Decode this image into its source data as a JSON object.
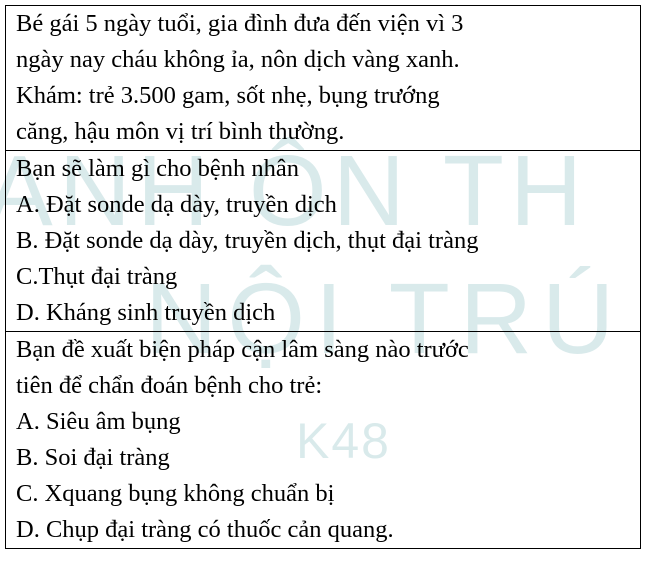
{
  "watermark": {
    "line1": "ANH ÔN TH",
    "line2": "NỘI TRÚ",
    "line3": "K48",
    "color": "#1a7f86"
  },
  "case": {
    "lines": [
      "Bé gái 5 ngày tuổi, gia đình đưa đến viện vì 3",
      "ngày nay cháu không ỉa, nôn dịch vàng xanh.",
      "Khám: trẻ 3.500 gam, sốt nhẹ, bụng trướng",
      "căng, hậu môn vị trí bình thường."
    ]
  },
  "question1": {
    "prompt": "Bạn sẽ làm gì cho bệnh nhân",
    "options": [
      "A. Đặt sonde dạ dày, truyền dịch",
      "B. Đặt sonde dạ dày, truyền dịch, thụt đại tràng",
      "C.Thụt đại tràng",
      "D. Kháng sinh truyền dịch"
    ]
  },
  "question2": {
    "prompt_lines": [
      "Bạn đề xuất biện pháp cận lâm sàng nào trước",
      "tiên để chẩn đoán bệnh cho trẻ:"
    ],
    "options": [
      "A. Siêu âm bụng",
      "B. Soi đại tràng",
      "C. Xquang bụng không chuẩn bị",
      "D. Chụp đại tràng có thuốc cản quang."
    ]
  }
}
